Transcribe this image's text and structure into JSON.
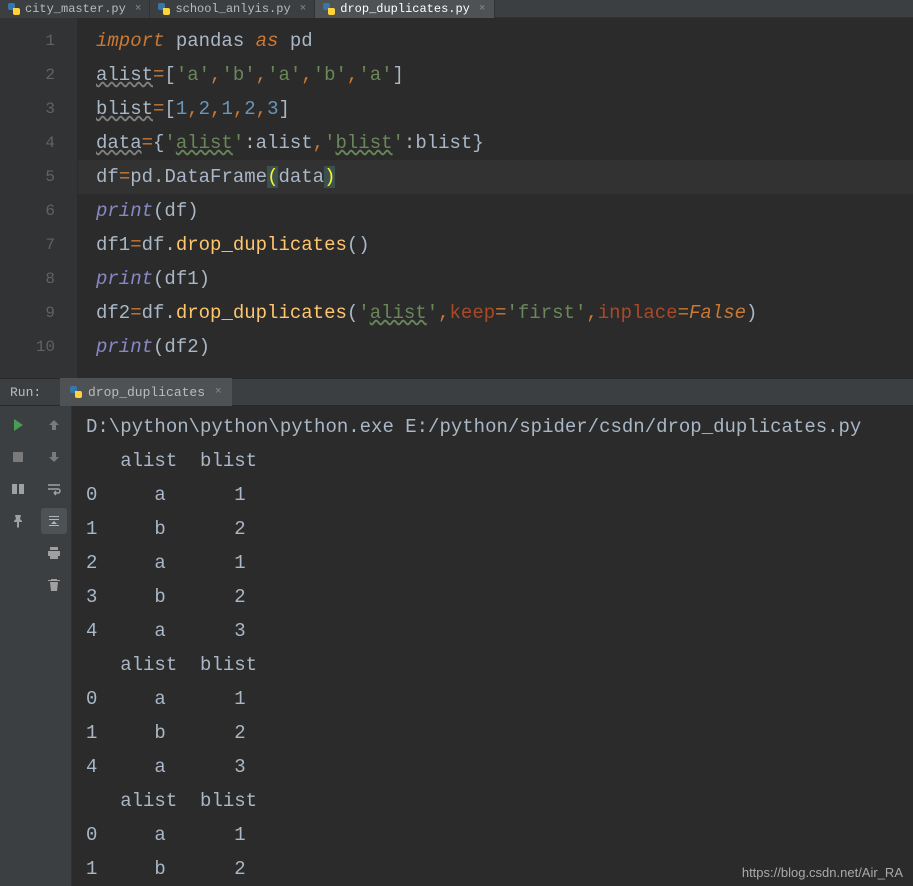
{
  "tabs": [
    {
      "label": "city_master.py",
      "active": false
    },
    {
      "label": "school_anlyis.py",
      "active": false
    },
    {
      "label": "drop_duplicates.py",
      "active": true
    }
  ],
  "line_numbers": [
    "1",
    "2",
    "3",
    "4",
    "5",
    "6",
    "7",
    "8",
    "9",
    "10"
  ],
  "code": {
    "l1": {
      "import": "import",
      "pandas": " pandas ",
      "as": "as",
      "pd": " pd"
    },
    "l2": {
      "var": "alist",
      "eq": "=",
      "lb": "[",
      "a1": "'a'",
      "c": ",",
      "b1": "'b'",
      "a2": "'a'",
      "b2": "'b'",
      "a3": "'a'",
      "rb": "]"
    },
    "l3": {
      "var": "blist",
      "eq": "=",
      "lb": "[",
      "n1": "1",
      "c": ",",
      "n2": "2",
      "n3": "1",
      "n4": "2",
      "n5": "3",
      "rb": "]"
    },
    "l4": {
      "var": "data",
      "eq": "=",
      "lb": "{",
      "k1": "'",
      "k1t": "alist",
      "k1e": "'",
      "colon": ":",
      "v1": "alist",
      "c": ",",
      "k2": "'",
      "k2t": "blist",
      "k2e": "'",
      "v2": "blist",
      "rb": "}"
    },
    "l5": {
      "var": "df",
      "eq": "=",
      "pd": "pd.",
      "cls": "DataFrame",
      "lp": "(",
      "arg": "data",
      "rp": ")"
    },
    "l6": {
      "print": "print",
      "lp": "(",
      "arg": "df",
      "rp": ")"
    },
    "l7": {
      "var": "df1",
      "eq": "=",
      "obj": "df.",
      "m": "drop_duplicates",
      "lp": "(",
      "rp": ")"
    },
    "l8": {
      "print": "print",
      "lp": "(",
      "arg": "df1",
      "rp": ")"
    },
    "l9": {
      "var": "df2",
      "eq": "=",
      "obj": "df.",
      "m": "drop_duplicates",
      "lp": "(",
      "s": "'",
      "st": "alist",
      "se": "'",
      "c": ",",
      "kw1": "keep",
      "eq1": "=",
      "v1": "'first'",
      "kw2": "inplace",
      "eq2": "=",
      "v2": "False",
      "rp": ")"
    },
    "l10": {
      "print": "print",
      "lp": "(",
      "arg": "df2",
      "rp": ")"
    }
  },
  "run": {
    "label": "Run:",
    "tab": "drop_duplicates",
    "cmd": "D:\\python\\python\\python.exe E:/python/spider/csdn/drop_duplicates.py",
    "lines": [
      {
        "pre": "   ",
        "h1": "alist",
        "sp1": "  ",
        "h2": "blist"
      },
      {
        "idx": "0",
        "sp": "     ",
        "v1": "a",
        "sp2": "      ",
        "v2": "1"
      },
      {
        "idx": "1",
        "sp": "     ",
        "v1": "b",
        "sp2": "      ",
        "v2": "2"
      },
      {
        "idx": "2",
        "sp": "     ",
        "v1": "a",
        "sp2": "      ",
        "v2": "1"
      },
      {
        "idx": "3",
        "sp": "     ",
        "v1": "b",
        "sp2": "      ",
        "v2": "2"
      },
      {
        "idx": "4",
        "sp": "     ",
        "v1": "a",
        "sp2": "      ",
        "v2": "3"
      },
      {
        "pre": "   ",
        "h1": "alist",
        "sp1": "  ",
        "h2": "blist"
      },
      {
        "idx": "0",
        "sp": "     ",
        "v1": "a",
        "sp2": "      ",
        "v2": "1"
      },
      {
        "idx": "1",
        "sp": "     ",
        "v1": "b",
        "sp2": "      ",
        "v2": "2"
      },
      {
        "idx": "4",
        "sp": "     ",
        "v1": "a",
        "sp2": "      ",
        "v2": "3"
      },
      {
        "pre": "   ",
        "h1": "alist",
        "sp1": "  ",
        "h2": "blist"
      },
      {
        "idx": "0",
        "sp": "     ",
        "v1": "a",
        "sp2": "      ",
        "v2": "1"
      },
      {
        "idx": "1",
        "sp": "     ",
        "v1": "b",
        "sp2": "      ",
        "v2": "2"
      }
    ]
  },
  "watermark": "https://blog.csdn.net/Air_RA"
}
